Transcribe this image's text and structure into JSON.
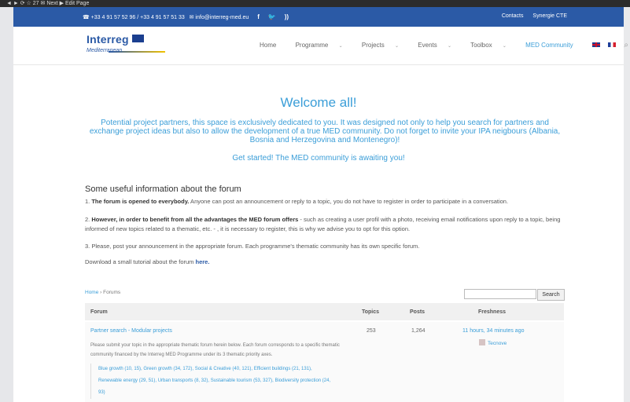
{
  "os_bar": {
    "text": "◄ ► ⟳  ☆ 27  ✉ Next  ▶ Edit Page"
  },
  "topbar": {
    "contact": "☎ +33 4 91 57 52 96 / +33 4 91 57 51 33",
    "email": "✉ info@interreg-med.eu",
    "contacts_link": "Contacts",
    "synergie_link": "Synergie CTE"
  },
  "logo": {
    "title": "Interreg",
    "subtitle": "Mediterranean"
  },
  "nav": [
    {
      "label": "Home",
      "chevron": false,
      "active": false
    },
    {
      "label": "Programme",
      "chevron": true,
      "active": false
    },
    {
      "label": "Projects",
      "chevron": true,
      "active": false
    },
    {
      "label": "Events",
      "chevron": true,
      "active": false
    },
    {
      "label": "Toolbox",
      "chevron": true,
      "active": false
    },
    {
      "label": "MED Community",
      "chevron": false,
      "active": true
    }
  ],
  "page": {
    "title": "Welcome all!",
    "intro": "Potential project partners, this space is exclusively dedicated to you. It was designed not only to help you search for partners and exchange project ideas but also to allow the development of a true MED community. Do not forget to invite your IPA neigbours (Albania, Bosnia and Herzegovina and Montenegro)!",
    "get_started": "Get started! The MED community is awaiting you!",
    "info_title": "Some useful information about the forum",
    "p1_bold": "The forum is opened to everybody.",
    "p1_rest": " Anyone can post an announcement or reply to a topic, you do not have to register in order to participate in a conversation.",
    "p2_bold": "However, in order to benefit from all the advantages the MED forum offers",
    "p2_rest": " - such as creating a user profil with a photo, receiving email notifications upon reply to a topic, being informed of new topics related to a thematic, etc. - , it is necessary to register, this is why we advise you to opt for this option.",
    "p3": "Please, post your announcement in the appropriate forum. Each programme's thematic community has its own specific forum.",
    "download_text": "Download a small tutorial about the forum ",
    "download_link": "here."
  },
  "forum": {
    "breadcrumb_home": "Home",
    "breadcrumb_sep": " › ",
    "breadcrumb_current": "Forums",
    "search_button": "Search",
    "headers": {
      "forum": "Forum",
      "topics": "Topics",
      "posts": "Posts",
      "freshness": "Freshness"
    },
    "rows": [
      {
        "title": "Partner search - Modular projects",
        "topics": "253",
        "posts": "1,264",
        "freshness": "11 hours, 34 minutes ago",
        "author": "Tecnove",
        "description": "Please submit your topic in the appropriate thematic forum herein below. Each forum corresponds to a specific thematic community financed by the Interreg MED Programme under its 3 thematic priority axes.",
        "subforums_line1": "Blue growth (10, 15), Green growth (34, 172), Social & Creative (40, 121), Efficient buildings (21, 131),",
        "subforums_line2": "Renewable energy (29, 51), Urban transports (8, 32), Sustainable tourism (53, 327), Biodiversity protection (24,",
        "subforums_line3": "93)"
      }
    ]
  }
}
